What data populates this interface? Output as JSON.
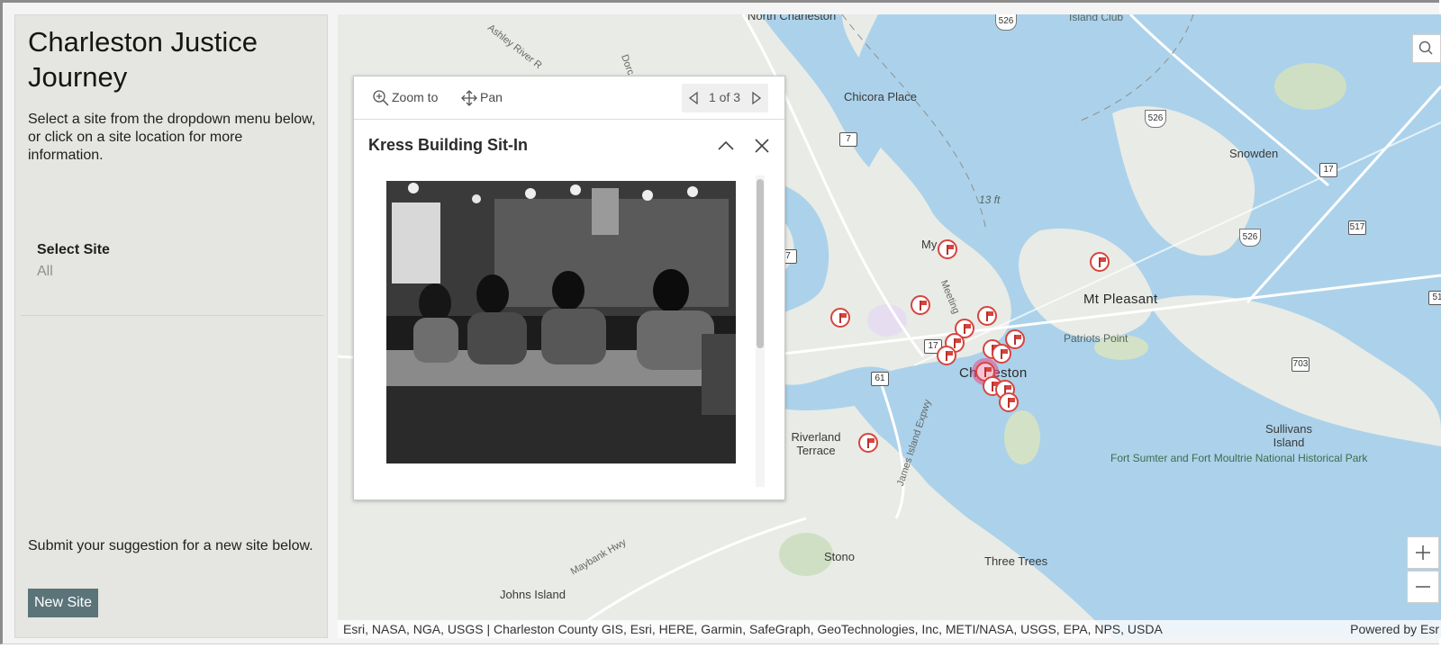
{
  "sidebar": {
    "title": "Charleston Justice Journey",
    "intro": "Select a site from the dropdown menu below, or click on a site location for more information.",
    "select_label": "Select Site",
    "select_value": "All",
    "suggest_text": "Submit your suggestion for a new site below.",
    "new_site_button": "New Site"
  },
  "popup": {
    "zoom_label": "Zoom to",
    "pan_label": "Pan",
    "pager_text": "1 of 3",
    "title": "Kress Building Sit-In"
  },
  "map": {
    "places": {
      "north_charleston": "North Charleston",
      "chicora_place": "Chicora Place",
      "snowden": "Snowden",
      "mt_pleasant": "Mt Pleasant",
      "charleston": "Charleston",
      "patriots_point": "Patriots Point",
      "riverland_terrace": "Riverland Terrace",
      "sullivans_island": "Sullivans Island",
      "stono": "Stono",
      "three_trees": "Three Trees",
      "johns_island": "Johns Island",
      "island_club": "Island Club",
      "my": "My",
      "fort_sumter": "Fort Sumter and Fort Moultrie National Historical Park",
      "elevation": "13 ft"
    },
    "roads": {
      "ashley_river": "Ashley River R",
      "dorchester": "Dorc",
      "meeting": "Meeting",
      "james_island": "James Island Expwy",
      "maybank": "Maybank Hwy"
    },
    "shields": {
      "r526a": "526",
      "r526b": "526",
      "r526c": "526",
      "r7a": "7",
      "r7b": "7",
      "r17a": "17",
      "r17b": "17",
      "r61": "61",
      "r517": "517",
      "r703": "703",
      "r51": "51"
    },
    "attribution": "Esri, NASA, NGA, USGS | Charleston County GIS, Esri, HERE, Garmin, SafeGraph, GeoTechnologies, Inc, METI/NASA, USGS, EPA, NPS, USDA",
    "powered_by": "Powered by Esr",
    "colors": {
      "water": "#abd2ea",
      "land": "#e9ebe6",
      "marker": "#d6453f",
      "selected_glow": "#e74a8a",
      "button": "#5b7479"
    }
  }
}
